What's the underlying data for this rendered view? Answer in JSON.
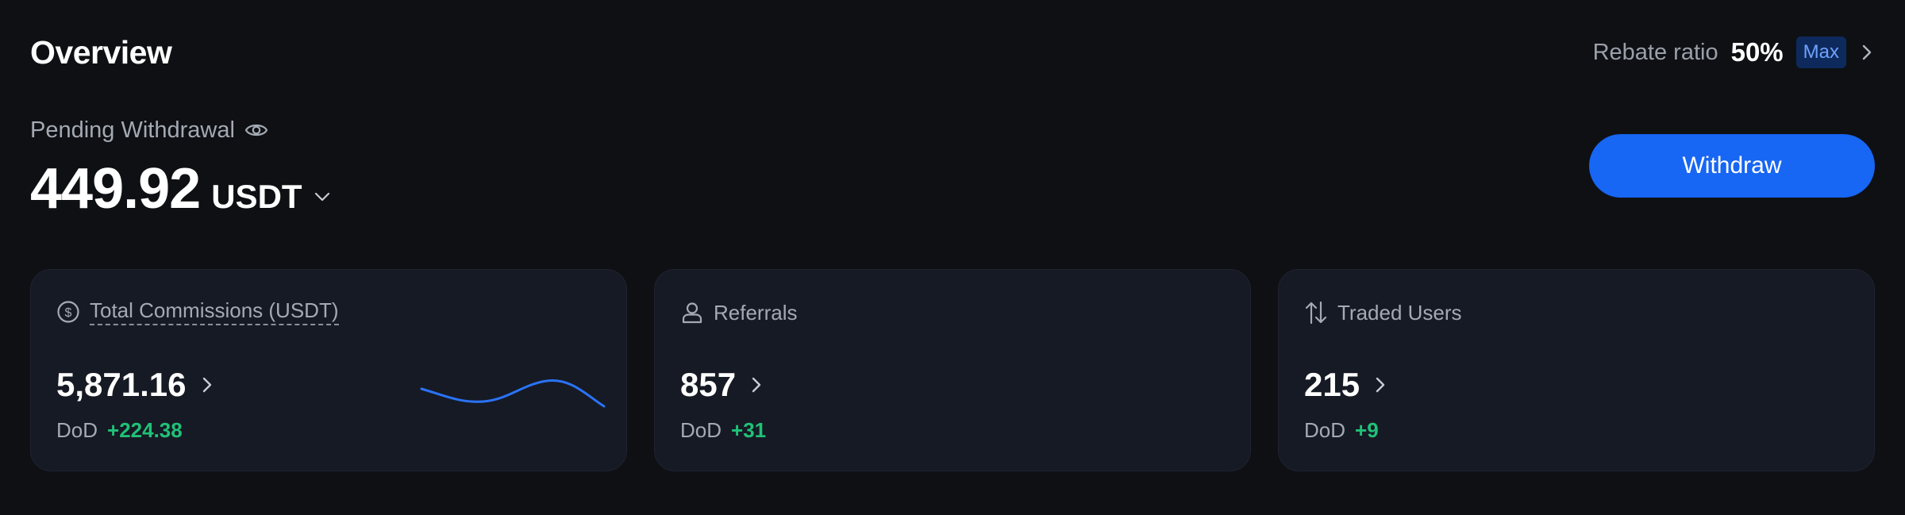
{
  "header": {
    "title": "Overview",
    "rebate_label": "Rebate ratio",
    "rebate_value": "50%",
    "rebate_badge": "Max"
  },
  "pending": {
    "label": "Pending Withdrawal",
    "amount": "449.92",
    "currency": "USDT"
  },
  "withdraw_button": {
    "label": "Withdraw"
  },
  "cards": [
    {
      "icon": "dollar-circle-icon",
      "title": "Total Commissions (USDT)",
      "value": "5,871.16",
      "dod_label": "DoD",
      "dod_value": "+224.38"
    },
    {
      "icon": "user-icon",
      "title": "Referrals",
      "value": "857",
      "dod_label": "DoD",
      "dod_value": "+31"
    },
    {
      "icon": "swap-vertical-icon",
      "title": "Traded Users",
      "value": "215",
      "dod_label": "DoD",
      "dod_value": "+9"
    }
  ],
  "colors": {
    "background": "#0f1014",
    "card": "#161a24",
    "accent": "#1766f4",
    "positive": "#20c177",
    "muted_text": "#a4aab4"
  }
}
